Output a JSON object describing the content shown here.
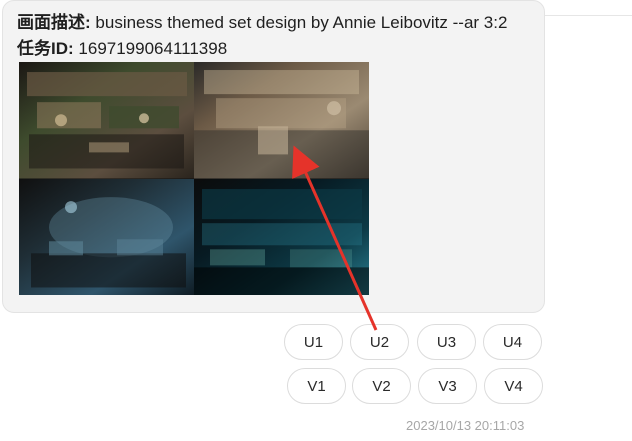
{
  "bubble": {
    "description_label": "画面描述:",
    "description_text": "business themed set design by Annie Leibovitz --ar 3:2",
    "task_id_label": "任务ID:",
    "task_id_value": "1697199064111398"
  },
  "image_grid": {
    "tiles": [
      {
        "name": "image-tile-1",
        "palette": [
          "#2a241d",
          "#5c4e3f",
          "#8f7a5c",
          "#3e4b2d",
          "#1b1714"
        ]
      },
      {
        "name": "image-tile-2",
        "palette": [
          "#4a4035",
          "#9b8a72",
          "#c9b79a",
          "#2b2a28",
          "#6c5a46"
        ]
      },
      {
        "name": "image-tile-3",
        "palette": [
          "#0f1c24",
          "#2f556b",
          "#6a95a8",
          "#101010",
          "#1f2e36"
        ]
      },
      {
        "name": "image-tile-4",
        "palette": [
          "#071a22",
          "#0d3a46",
          "#2a8194",
          "#0b0b0b",
          "#6bb3a7"
        ]
      }
    ]
  },
  "actions": {
    "upscale": [
      "U1",
      "U2",
      "U3",
      "U4"
    ],
    "variation": [
      "V1",
      "V2",
      "V3",
      "V4"
    ]
  },
  "timestamp": "2023/10/13 20:11:03",
  "colors": {
    "arrow": "#e5332a"
  }
}
